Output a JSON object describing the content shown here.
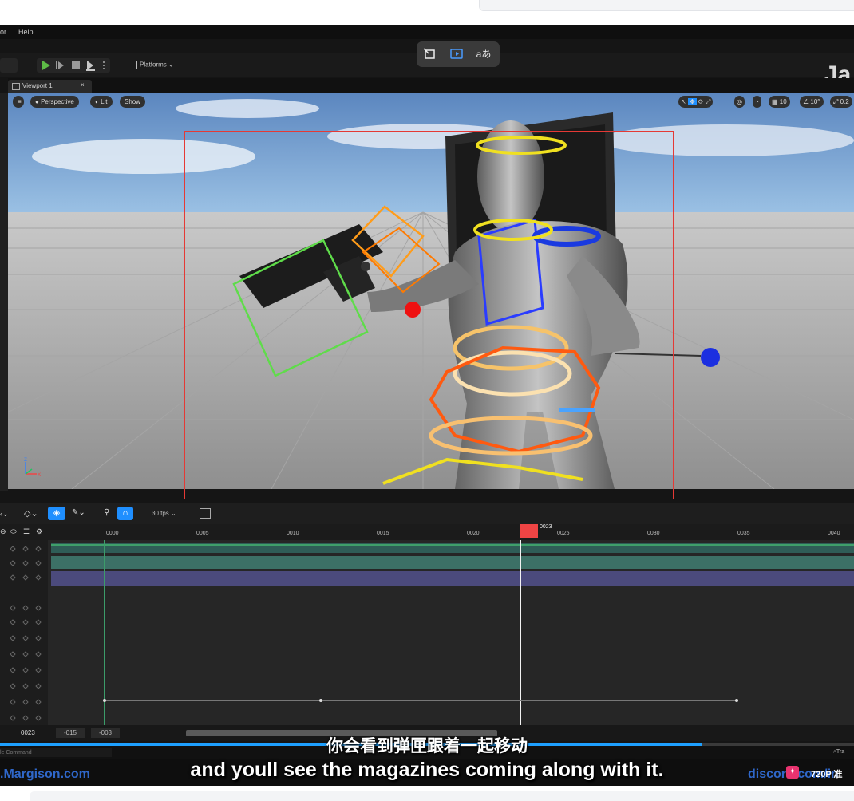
{
  "menubar": {
    "items": [
      "or",
      "Help"
    ]
  },
  "toolbar": {
    "platforms_label": "Platforms"
  },
  "overlay": {
    "icons": [
      "screen-exit-icon",
      "video-icon",
      "translate-icon"
    ],
    "translate_glyph": "aあ"
  },
  "watermark": {
    "text": "Ja"
  },
  "viewport": {
    "tab_label": "Viewport 1",
    "tab_close": "×",
    "view_mode": "Perspective",
    "lit_label": "Lit",
    "show_label": "Show",
    "grid_snap": "10",
    "rotation_snap": "10°",
    "scale_snap": "0.2"
  },
  "sequencer": {
    "fps_label": "30 fps",
    "current_frame_marker": "0023",
    "ruler_ticks": [
      "0000",
      "0005",
      "0010",
      "0015",
      "0020",
      "0025",
      "0030",
      "0035",
      "0040"
    ],
    "current_frame": "0023",
    "range_start": "-015",
    "range_end": "-003"
  },
  "status": {
    "command_placeholder": "le Command",
    "trace_label": "Tra",
    "left_link": ".Margison.com",
    "right_link": "discord.com/in"
  },
  "player": {
    "quality_badge": "720P 准"
  },
  "subtitles": {
    "chinese": "你会看到弹匣跟着一起移动",
    "english": "and youll see the magazines coming along with it."
  },
  "colors": {
    "accent_blue": "#1f8fff",
    "play_green": "#5dbb46",
    "playhead_red": "#ef4444",
    "selection_red": "#e53935",
    "progress_blue": "#1ea0ff"
  }
}
